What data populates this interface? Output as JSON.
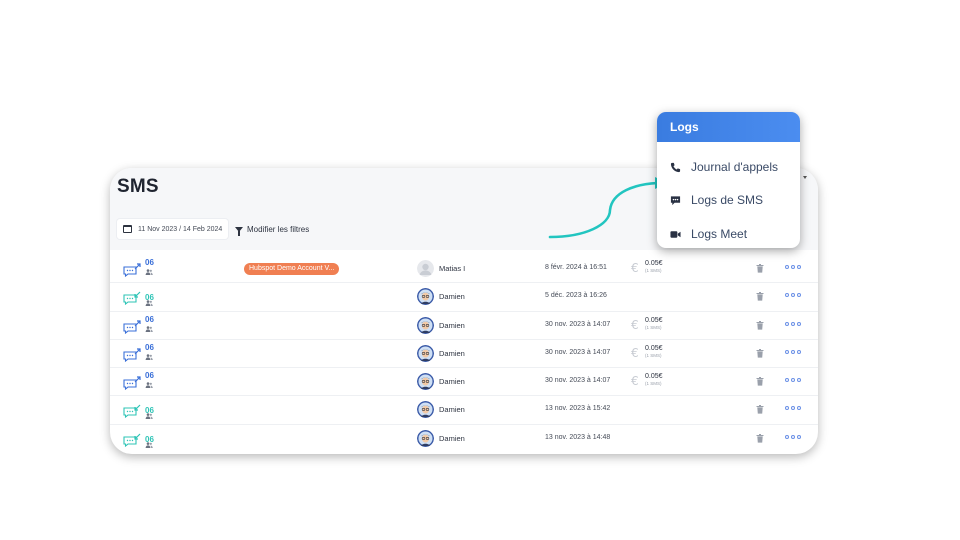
{
  "page_title": "SMS",
  "filters": {
    "date_range": "11 Nov 2023 / 14 Feb 2024",
    "modify_label": "Modifier les filtres"
  },
  "rows": [
    {
      "direction": "outgoing",
      "number": "06",
      "tag": "Hubspot Demo Account V...",
      "user": "Matias I",
      "avatar": "placeholder",
      "date": "8 févr. 2024 à 16:51",
      "cost": "0.05€",
      "cost_detail": "(1 SMS)"
    },
    {
      "direction": "incoming",
      "number": "06",
      "tag": "",
      "user": "Damien",
      "avatar": "illustrated",
      "date": "5 déc. 2023 à 16:26",
      "cost": "",
      "cost_detail": ""
    },
    {
      "direction": "outgoing",
      "number": "06",
      "tag": "",
      "user": "Damien",
      "avatar": "illustrated",
      "date": "30 nov. 2023 à 14:07",
      "cost": "0.05€",
      "cost_detail": "(1 SMS)"
    },
    {
      "direction": "outgoing",
      "number": "06",
      "tag": "",
      "user": "Damien",
      "avatar": "illustrated",
      "date": "30 nov. 2023 à 14:07",
      "cost": "0.05€",
      "cost_detail": "(1 SMS)"
    },
    {
      "direction": "outgoing",
      "number": "06",
      "tag": "",
      "user": "Damien",
      "avatar": "illustrated",
      "date": "30 nov. 2023 à 14:07",
      "cost": "0.05€",
      "cost_detail": "(1 SMS)"
    },
    {
      "direction": "incoming",
      "number": "06",
      "tag": "",
      "user": "Damien",
      "avatar": "illustrated",
      "date": "13 nov. 2023 à 15:42",
      "cost": "",
      "cost_detail": ""
    },
    {
      "direction": "incoming",
      "number": "06",
      "tag": "",
      "user": "Damien",
      "avatar": "illustrated",
      "date": "13 nov. 2023 à 14:48",
      "cost": "",
      "cost_detail": ""
    }
  ],
  "logs_menu": {
    "title": "Logs",
    "items": [
      {
        "label": "Journal d'appels",
        "icon": "phone-icon"
      },
      {
        "label": "Logs de SMS",
        "icon": "chat-bubble-icon"
      },
      {
        "label": "Logs Meet",
        "icon": "video-camera-icon"
      }
    ]
  },
  "colors": {
    "accent_blue": "#3a7ce0",
    "incoming_teal": "#2ec4b6",
    "outgoing_blue": "#3a6fd8",
    "tag_orange": "#f07f52",
    "arrow_teal": "#22c5c0"
  }
}
